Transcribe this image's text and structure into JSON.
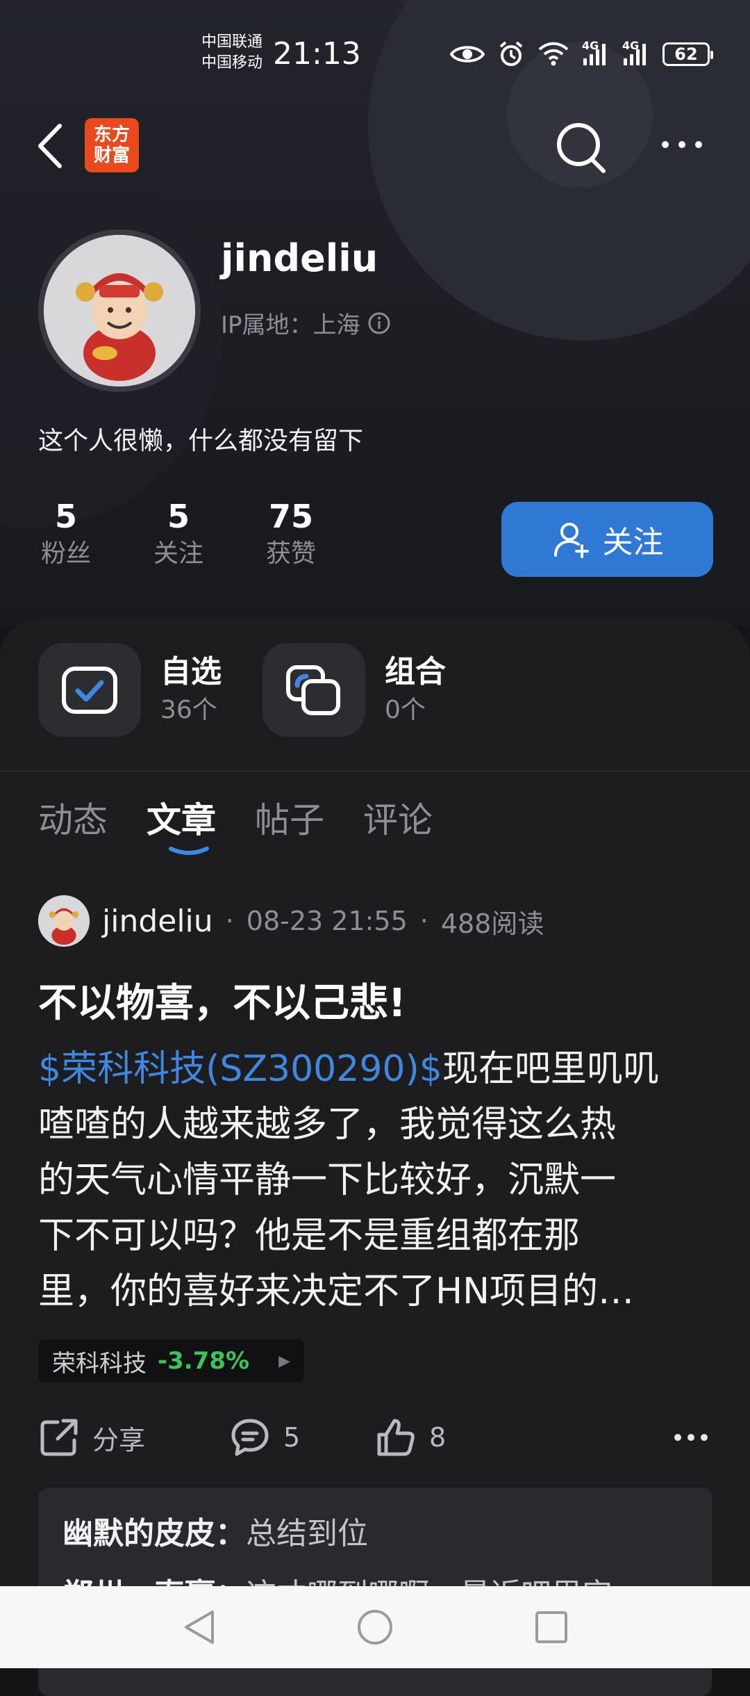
{
  "status_bar": {
    "carrier_1": "中国联通",
    "carrier_2": "中国移动",
    "time": "21:13",
    "battery": "62",
    "network_1": "4G",
    "network_2": "4G"
  },
  "top_nav": {
    "brand_line1": "东方",
    "brand_line2": "财富"
  },
  "profile": {
    "username": "jindeliu",
    "ip_location": "IP属地：上海",
    "bio": "这个人很懒，什么都没有留下",
    "stats": [
      {
        "num": "5",
        "label": "粉丝"
      },
      {
        "num": "5",
        "label": "关注"
      },
      {
        "num": "75",
        "label": "获赞"
      }
    ],
    "follow_label": "关注"
  },
  "quick_links": [
    {
      "title": "自选",
      "sub": "36个"
    },
    {
      "title": "组合",
      "sub": "0个"
    }
  ],
  "tabs": [
    {
      "label": "动态",
      "active": false
    },
    {
      "label": "文章",
      "active": true
    },
    {
      "label": "帖子",
      "active": false
    },
    {
      "label": "评论",
      "active": false
    }
  ],
  "post": {
    "author": "jindeliu",
    "time": "08-23 21:55",
    "reads": "488阅读",
    "title": "不以物喜，不以己悲!",
    "ticker": "$荣科科技(SZ300290)$",
    "body_line1": "现在吧里叽叽",
    "body_line2": "喳喳的人越来越多了，我觉得这么热",
    "body_line3": "的天气心情平静一下比较好，沉默一",
    "body_line4": "下不可以吗？他是不是重组都在那",
    "body_line5": "里，你的喜好来决定不了HN项目的…",
    "stock_name": "荣科科技",
    "stock_change": "-3.78%",
    "share_label": "分享",
    "comment_count": "5",
    "like_count": "8"
  },
  "comments": [
    {
      "who": "幽默的皮皮",
      "sep": "：",
      "text": "总结到位"
    },
    {
      "who": "郑州一直赢",
      "sep": "：",
      "text": "这才哪到哪啊，最近吧里实"
    }
  ],
  "colors": {
    "accent_blue": "#2f78d3",
    "link_blue": "#3f87e0",
    "stock_down_green": "#3ec25a",
    "brand_orange": "#e8491d"
  }
}
